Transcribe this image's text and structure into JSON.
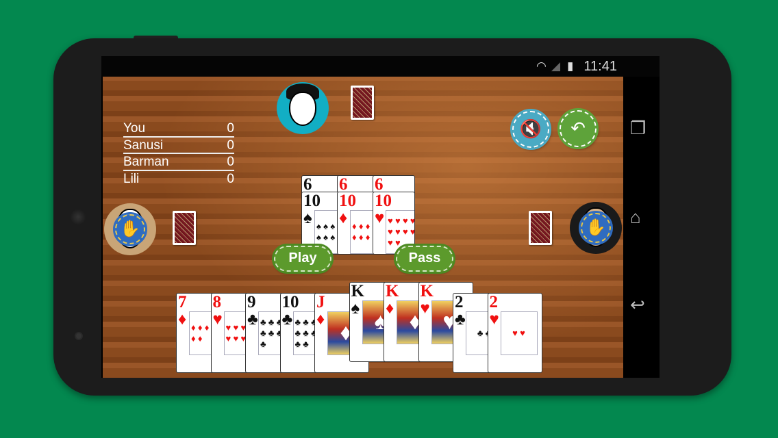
{
  "status_bar": {
    "time": "11:41",
    "icons": [
      "wifi-icon",
      "signal-icon",
      "battery-icon"
    ]
  },
  "nav_bar": {
    "icons": [
      "recent-apps-icon",
      "home-icon",
      "back-icon"
    ]
  },
  "scoreboard": [
    {
      "name": "You",
      "score": "0"
    },
    {
      "name": "Sanusi",
      "score": "0"
    },
    {
      "name": "Barman",
      "score": "0"
    },
    {
      "name": "Lili",
      "score": "0"
    }
  ],
  "opponents": {
    "top": {
      "avatar_color": "#12aec4",
      "state": "playing"
    },
    "left": {
      "avatar_color": "#c9a577",
      "state": "passed"
    },
    "right": {
      "avatar_color": "#1a1a1a",
      "state": "passed"
    }
  },
  "controls": {
    "mute": {
      "icon": "speaker-muted-icon",
      "color": "#4aaac4"
    },
    "undo": {
      "icon": "undo-arrow-icon",
      "color": "#5ea33a"
    },
    "play_label": "Play",
    "pass_label": "Pass"
  },
  "table_cards": {
    "previous": [
      {
        "rank": "6",
        "suit": "♠"
      },
      {
        "rank": "6",
        "suit": "♦"
      },
      {
        "rank": "6",
        "suit": "♥"
      }
    ],
    "current": [
      {
        "rank": "10",
        "suit": "♠"
      },
      {
        "rank": "10",
        "suit": "♦"
      },
      {
        "rank": "10",
        "suit": "♥"
      }
    ]
  },
  "hand": [
    {
      "rank": "7",
      "suit": "♦",
      "selected": false
    },
    {
      "rank": "8",
      "suit": "♥",
      "selected": false
    },
    {
      "rank": "9",
      "suit": "♣",
      "selected": false
    },
    {
      "rank": "10",
      "suit": "♣",
      "selected": false
    },
    {
      "rank": "J",
      "suit": "♦",
      "selected": false
    },
    {
      "rank": "K",
      "suit": "♠",
      "selected": true
    },
    {
      "rank": "K",
      "suit": "♦",
      "selected": true
    },
    {
      "rank": "K",
      "suit": "♥",
      "selected": true
    },
    {
      "rank": "2",
      "suit": "♣",
      "selected": false
    },
    {
      "rank": "2",
      "suit": "♥",
      "selected": false
    }
  ]
}
